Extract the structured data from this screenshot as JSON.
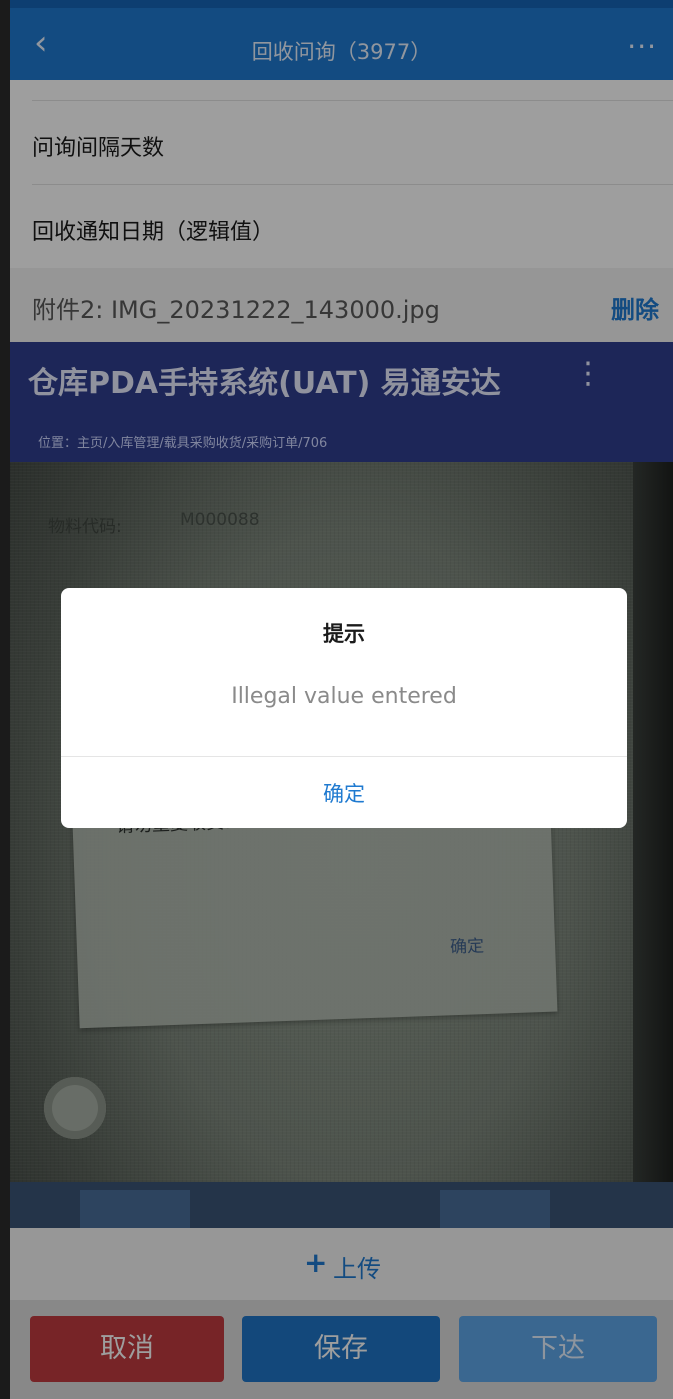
{
  "header": {
    "back_icon": "chevron-left-icon",
    "title": "回收问询（3977）",
    "more_icon": "more-dots-icon"
  },
  "form": {
    "field_inquiry_interval": "问询间隔天数",
    "field_recovery_notice_date": "回收通知日期（逻辑值）"
  },
  "attachment": {
    "name": "附件2: IMG_20231222_143000.jpg",
    "delete_label": "删除"
  },
  "photo": {
    "pda_title": "仓库PDA手持系统(UAT) 易通安达",
    "pda_path": "位置：主页/入库管理/载具采购收货/采购订单/706",
    "field_label": "物料代码:",
    "field_value": "M000088",
    "inner_message": "请勿重复收货!",
    "inner_ok": "确定"
  },
  "upload": {
    "icon": "plus-icon",
    "label": "上传"
  },
  "footer": {
    "cancel_label": "取消",
    "save_label": "保存",
    "issue_label": "下达"
  },
  "alert": {
    "title": "提示",
    "message": "Illegal value entered",
    "confirm_label": "确定"
  },
  "colors": {
    "header_blue": "#1f7ad0",
    "cancel_red": "#c13a40",
    "save_blue": "#1f74c7",
    "issue_light_blue": "#5ea7e8"
  }
}
